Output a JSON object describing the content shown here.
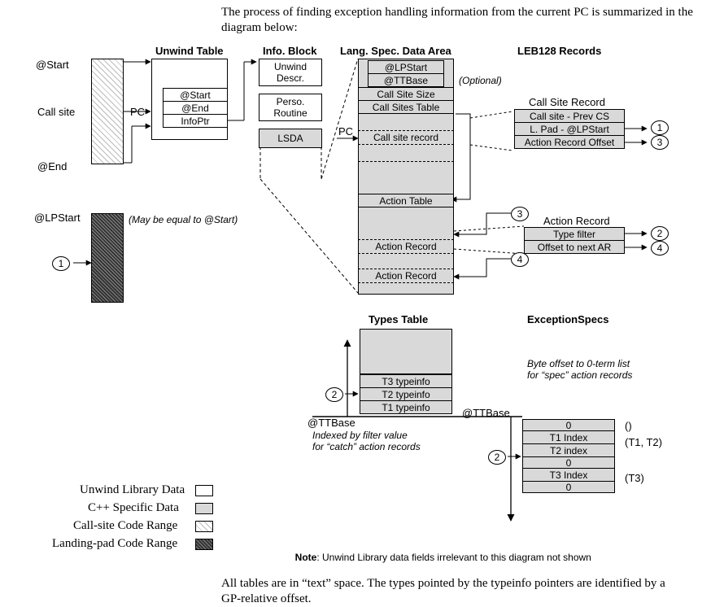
{
  "intro": "The process of finding exception handling information from the current PC\nis summarized in the diagram below:",
  "outro": "All tables are in “text” space. The types pointed by the typeinfo pointers are\nidentified by a GP-relative offset.",
  "headers": {
    "unwind_table": "Unwind Table",
    "info_block": "Info. Block",
    "lsda": "Lang. Spec. Data Area",
    "leb": "LEB128 Records",
    "types_table": "Types Table",
    "exception_specs": "ExceptionSpecs"
  },
  "labels": {
    "at_start": "@Start",
    "call_site": "Call site",
    "at_end": "@End",
    "at_lpstart": "@LPStart",
    "pc": "PC",
    "may_equal": "(May be equal to @Start)",
    "optional": "(Optional)",
    "ttbase1": "@TTBase",
    "ttbase2": "@TTBase",
    "filter_note": "Indexed by filter value\nfor “catch” action records",
    "spec_note": "Byte offset to 0-term list\nfor “spec” action records",
    "note": "Note",
    "note_rest": ": Unwind Library data fields irrelevant to this diagram not shown",
    "call_site_record": "Call Site Record",
    "action_record": "Action Record"
  },
  "unwind_table_rows": {
    "start": "@Start",
    "end": "@End",
    "infoptr": "InfoPtr"
  },
  "info_block_rows": {
    "descr": "Unwind\nDescr.",
    "perso": "Perso.\nRoutine",
    "lsda": "LSDA"
  },
  "lsda_rows": {
    "lpstart": "@LPStart",
    "ttbase": "@TTBase",
    "css": "Call Site Size",
    "cst": "Call Sites Table",
    "csr": "Call site record",
    "at": "Action Table",
    "ar1": "Action Record",
    "ar2": "Action Record"
  },
  "csr_rows": {
    "r1": "Call site - Prev CS",
    "r2": "L. Pad - @LPStart",
    "r3": "Action Record Offset"
  },
  "ar_rows": {
    "r1": "Type filter",
    "r2": "Offset to next AR"
  },
  "types_rows": {
    "t3": "T3 typeinfo",
    "t2": "T2 typeinfo",
    "t1": "T1 typeinfo"
  },
  "specs_rows": {
    "z1": "0",
    "t1": "T1 Index",
    "t2": "T2 index",
    "z2": "0",
    "t3": "T3 Index",
    "z3": "0"
  },
  "specs_side": {
    "empty": "()",
    "t12": "(T1, T2)",
    "t3": "(T3)"
  },
  "legend": {
    "unwind": "Unwind Library Data",
    "cpp": "C++ Specific Data",
    "callsite": "Call-site Code Range",
    "lpad": "Landing-pad Code Range"
  },
  "nums": {
    "n1": "1",
    "n2": "2",
    "n3": "3",
    "n4": "4"
  }
}
